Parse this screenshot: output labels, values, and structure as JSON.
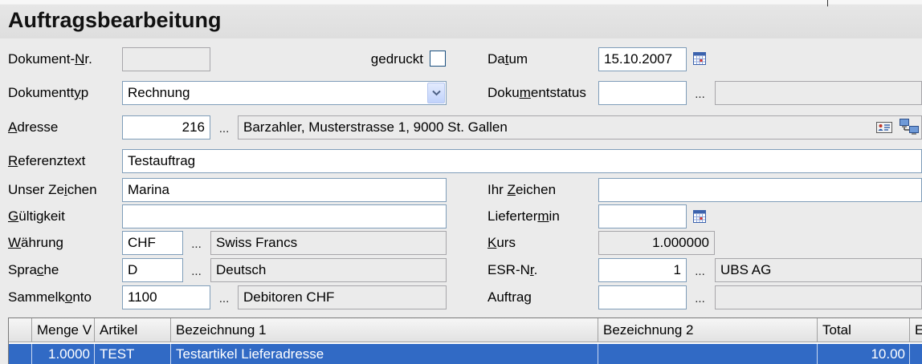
{
  "window": {
    "title": "Auftragsbearbeitung"
  },
  "colors": {
    "background": "#ebebeb",
    "input_border": "#7f9db9",
    "selection": "#316ac5"
  },
  "lookup_button_label": "...",
  "icons": {
    "datum_picker": "calendar-icon",
    "liefertermin_picker": "calendar-icon",
    "adresse_card": "address-card-icon",
    "adresse_network": "network-icon",
    "dokumenttyp_dropdown": "chevron-down-icon"
  },
  "form": {
    "dokument_nr": {
      "label": "Dokument-Nr.",
      "ul": 9,
      "value": ""
    },
    "gedruckt": {
      "label": "gedruckt",
      "checked": false
    },
    "datum": {
      "label": "Datum",
      "ul": 2,
      "value": "15.10.2007"
    },
    "dokumenttyp": {
      "label": "Dokumenttyp",
      "ul": 9,
      "value": "Rechnung"
    },
    "dokumentstatus": {
      "label": "Dokumentstatus",
      "ul": 4,
      "value": "",
      "description": ""
    },
    "adresse": {
      "label": "Adresse",
      "ul": 0,
      "value": "216",
      "description": "Barzahler, Musterstrasse 1, 9000 St. Gallen"
    },
    "referenztext": {
      "label": "Referenztext",
      "ul": 0,
      "value": "Testauftrag"
    },
    "unser_zeichen": {
      "label": "Unser Zeichen",
      "ul": 8,
      "value": "Marina"
    },
    "ihr_zeichen": {
      "label": "Ihr Zeichen",
      "ul": 4,
      "value": ""
    },
    "gueltigkeit": {
      "label": "Gültigkeit",
      "ul": 0,
      "value": ""
    },
    "liefertermin": {
      "label": "Liefertermin",
      "ul": 9,
      "value": ""
    },
    "waehrung": {
      "label": "Währung",
      "ul": 0,
      "value": "CHF",
      "description": "Swiss Francs"
    },
    "kurs": {
      "label": "Kurs",
      "ul": 0,
      "value": "1.000000"
    },
    "sprache": {
      "label": "Sprache",
      "ul": 4,
      "value": "D",
      "description": "Deutsch"
    },
    "esr_nr": {
      "label": "ESR-Nr.",
      "ul": 5,
      "value": "1",
      "description": "UBS AG"
    },
    "sammelkonto": {
      "label": "Sammelkonto",
      "ul": 7,
      "value": "1100",
      "description": "Debitoren CHF"
    },
    "auftrag": {
      "label": "Auftrag",
      "value": "",
      "description": ""
    }
  },
  "grid": {
    "columns": [
      "Menge V",
      "Artikel",
      "Bezeichnung 1",
      "Bezeichnung 2",
      "Total",
      "E"
    ],
    "rows": [
      {
        "menge": "1.0000",
        "artikel": "TEST",
        "bezeichnung1": "Testartikel Lieferadresse",
        "bezeichnung2": "",
        "total": "10.00",
        "extra": "",
        "selected": true
      }
    ]
  }
}
